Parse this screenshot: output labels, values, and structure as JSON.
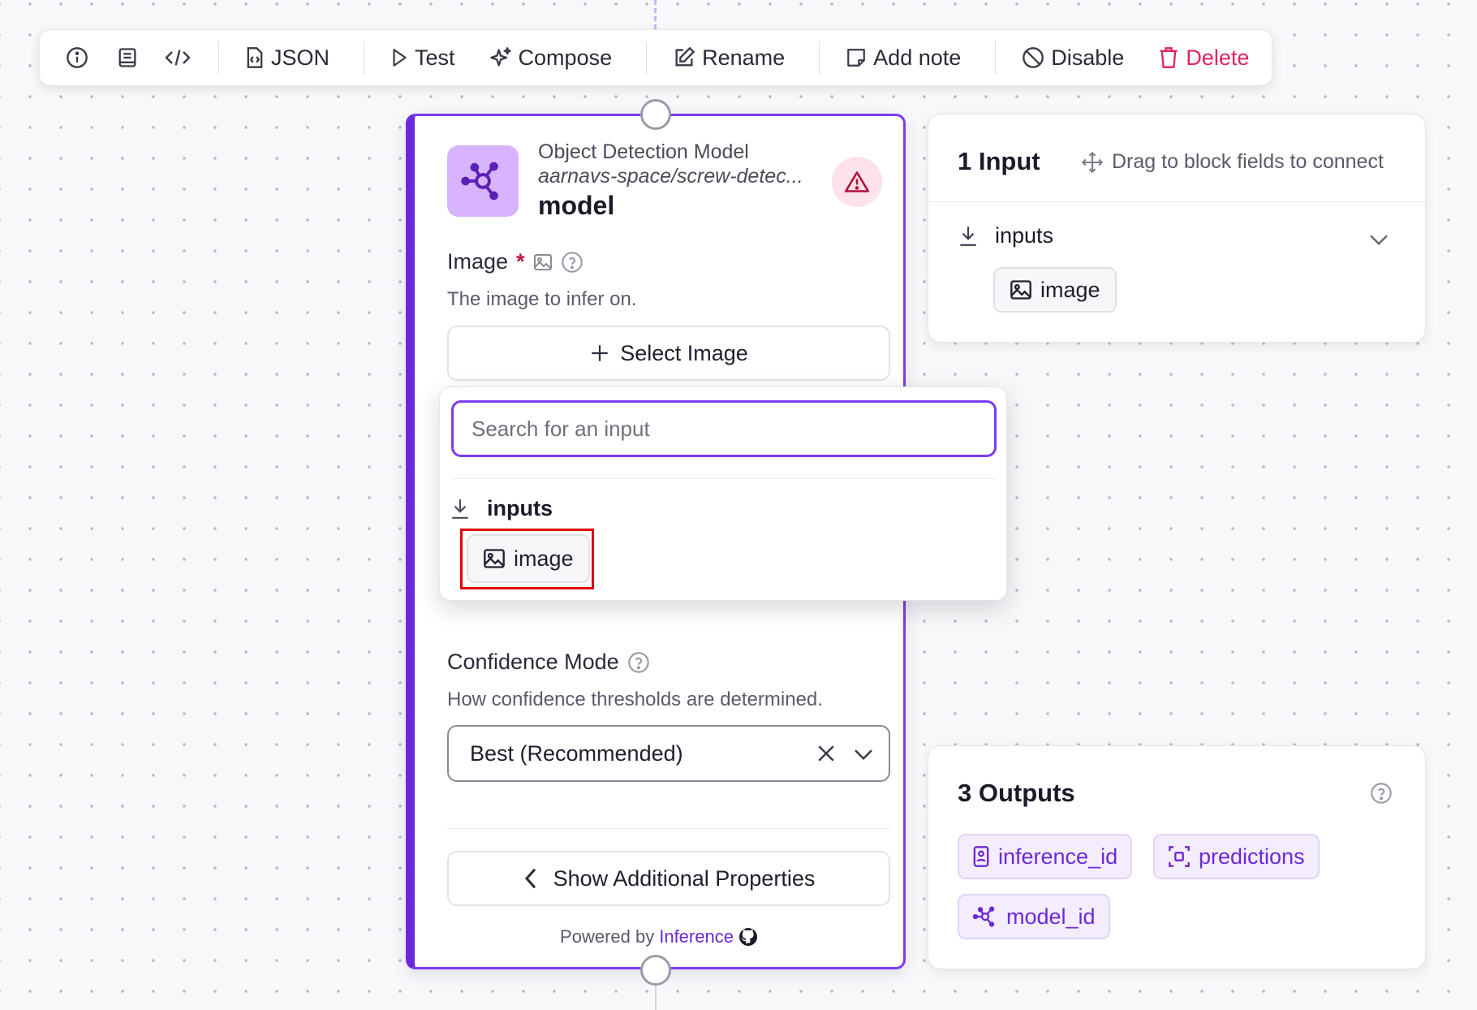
{
  "toolbar": {
    "json_label": "JSON",
    "test_label": "Test",
    "compose_label": "Compose",
    "rename_label": "Rename",
    "add_note_label": "Add note",
    "disable_label": "Disable",
    "delete_label": "Delete"
  },
  "node": {
    "type": "Object Detection Model",
    "model_id": "aarnavs-space/screw-detec...",
    "name": "model",
    "image_field": {
      "label": "Image",
      "required_mark": "*",
      "description": "The image to infer on.",
      "select_button": "Select Image"
    },
    "confidence_field": {
      "label": "Confidence Mode",
      "description": "How confidence thresholds are determined.",
      "selected": "Best (Recommended)"
    },
    "show_additional": "Show Additional Properties",
    "powered_by": "Powered by",
    "powered_brand": "Inference"
  },
  "dropdown": {
    "search_placeholder": "Search for an input",
    "search_value": "",
    "group_label": "inputs",
    "items": [
      {
        "label": "image"
      }
    ]
  },
  "inputs_panel": {
    "title": "1 Input",
    "hint": "Drag to block fields to connect",
    "group_label": "inputs",
    "items": [
      {
        "label": "image"
      }
    ]
  },
  "outputs_panel": {
    "title": "3 Outputs",
    "items": [
      {
        "label": "inference_id"
      },
      {
        "label": "predictions"
      },
      {
        "label": "model_id"
      }
    ]
  },
  "colors": {
    "accent": "#7c3aed",
    "accent_dark": "#6d28d9",
    "danger": "#e0245e",
    "highlight": "#e00000"
  }
}
